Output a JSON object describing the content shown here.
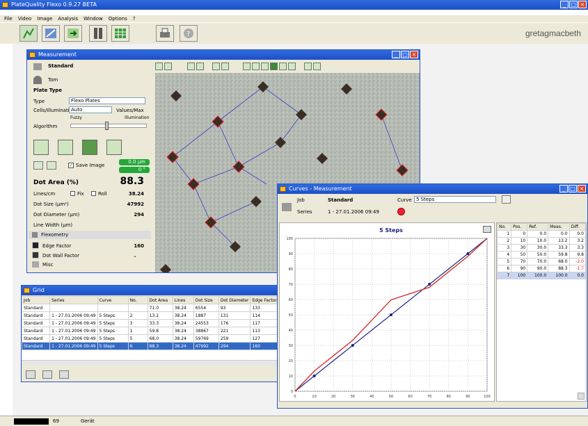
{
  "app": {
    "title": "PlateQuality Flexo 0.9.27 BETA",
    "menu": [
      "File",
      "Video",
      "Image",
      "Analysis",
      "Window",
      "Options",
      "?"
    ],
    "brand": "gretagmacbeth"
  },
  "measurement": {
    "title": "Measurement",
    "job_label": "Standard",
    "user_label": "Tom",
    "plate_type_label": "Plate Type",
    "type_label": "Type",
    "type_value": "Flexo Plates",
    "cells_label": "Cells/Illumination",
    "cells_value": "Auto",
    "values_label": "Values/Max",
    "slider_left_label": "Fuzzy",
    "slider_right_label": "Illumination",
    "algorithm_label": "Algorithm",
    "save_image_label": "Save Image",
    "green_top_value": "0.0 µm",
    "green_bottom_value": "0 °",
    "dot_area_label": "Dot Area (%)",
    "dot_area_value": "88.3",
    "lines_label": "Lines/cm",
    "lines_value": "38.24",
    "opt_fix": "Fix",
    "opt_roll": "Roll",
    "dot_size_label": "Dot Size (µm²)",
    "dot_size_value": "47992",
    "dot_diameter_label": "Dot Diameter (µm)",
    "dot_diameter_value": "294",
    "line_width_label": "Line Width (µm)",
    "section_flexo": "Flexometry",
    "edge_factor_label": "Edge Factor",
    "edge_factor_value": "160",
    "dot_wall_label": "Dot Wall Factor",
    "misc_label": "Misc"
  },
  "grid": {
    "title": "Grid",
    "columns": [
      "Job",
      "Series",
      "Curve",
      "No.",
      "Dot Area",
      "Lines",
      "Dot Size",
      "Dot Diameter",
      "Edge Factor"
    ],
    "rows": [
      [
        "Standard",
        "",
        "",
        "",
        "71.0",
        "38.24",
        "6554",
        "93",
        "133"
      ],
      [
        "Standard",
        "1 - 27.01.2006 09:49",
        "5 Steps",
        "2",
        "13.2",
        "38.24",
        "1887",
        "131",
        "114"
      ],
      [
        "Standard",
        "1 - 27.01.2006 09:49",
        "5 Steps",
        "3",
        "33.3",
        "38.24",
        "24553",
        "176",
        "117"
      ],
      [
        "Standard",
        "1 - 27.01.2006 09:49",
        "5 Steps",
        "1",
        "59.8",
        "38.24",
        "38867",
        "221",
        "113"
      ],
      [
        "Standard",
        "1 - 27.01.2006 09:49",
        "5 Steps",
        "5",
        "68.0",
        "38.24",
        "59769",
        "259",
        "127"
      ],
      [
        "Standard",
        "1 - 27.01.2006 09:49",
        "5 Steps",
        "6",
        "88.3",
        "38.24",
        "47992",
        "294",
        "160"
      ]
    ],
    "selected_row": 5
  },
  "curves": {
    "title": "Curves - Measurement",
    "job_label": "Job",
    "job_value": "Standard",
    "series_label": "Series",
    "series_value": "1 - 27.01.2006 09:49",
    "curve_label": "Curve",
    "curve_value": "5 Steps",
    "table_columns": [
      "No.",
      "Pos.",
      "Ref.",
      "Meas.",
      "Diff."
    ],
    "table_rows": [
      [
        "1",
        "0",
        "0.0",
        "0.0",
        "0.0"
      ],
      [
        "2",
        "10",
        "10.0",
        "13.2",
        "3.2"
      ],
      [
        "3",
        "30",
        "30.0",
        "33.3",
        "3.3"
      ],
      [
        "4",
        "50",
        "50.0",
        "59.8",
        "9.8"
      ],
      [
        "5",
        "70",
        "70.0",
        "68.0",
        "-2.0"
      ],
      [
        "6",
        "90",
        "90.0",
        "88.3",
        "-1.7"
      ],
      [
        "7",
        "100",
        "100.0",
        "100.0",
        "0.0"
      ]
    ],
    "selected_row": 6
  },
  "chart_data": {
    "type": "line",
    "title": "5 Steps",
    "xlim": [
      0,
      100
    ],
    "ylim": [
      0,
      100
    ],
    "x_ticks": [
      "0",
      "10",
      "20",
      "30",
      "40",
      "50",
      "60",
      "70",
      "80",
      "90",
      "100"
    ],
    "y_ticks": [
      "0",
      "10",
      "20",
      "30",
      "40",
      "50",
      "60",
      "70",
      "80",
      "90",
      "100"
    ],
    "grid": true,
    "series": [
      {
        "color": "#1a237e",
        "x": [
          0,
          100
        ],
        "y": [
          0,
          100
        ]
      },
      {
        "color": "#d32f2f",
        "x": [
          0,
          10,
          30,
          50,
          70,
          90,
          100
        ],
        "y": [
          0,
          13.2,
          33.3,
          59.8,
          68.0,
          88.3,
          100
        ]
      }
    ],
    "markers": [
      [
        10,
        10
      ],
      [
        30,
        30
      ],
      [
        50,
        50
      ],
      [
        70,
        70
      ],
      [
        90,
        90
      ]
    ]
  },
  "status": {
    "left": "69",
    "right": "Gerät"
  }
}
